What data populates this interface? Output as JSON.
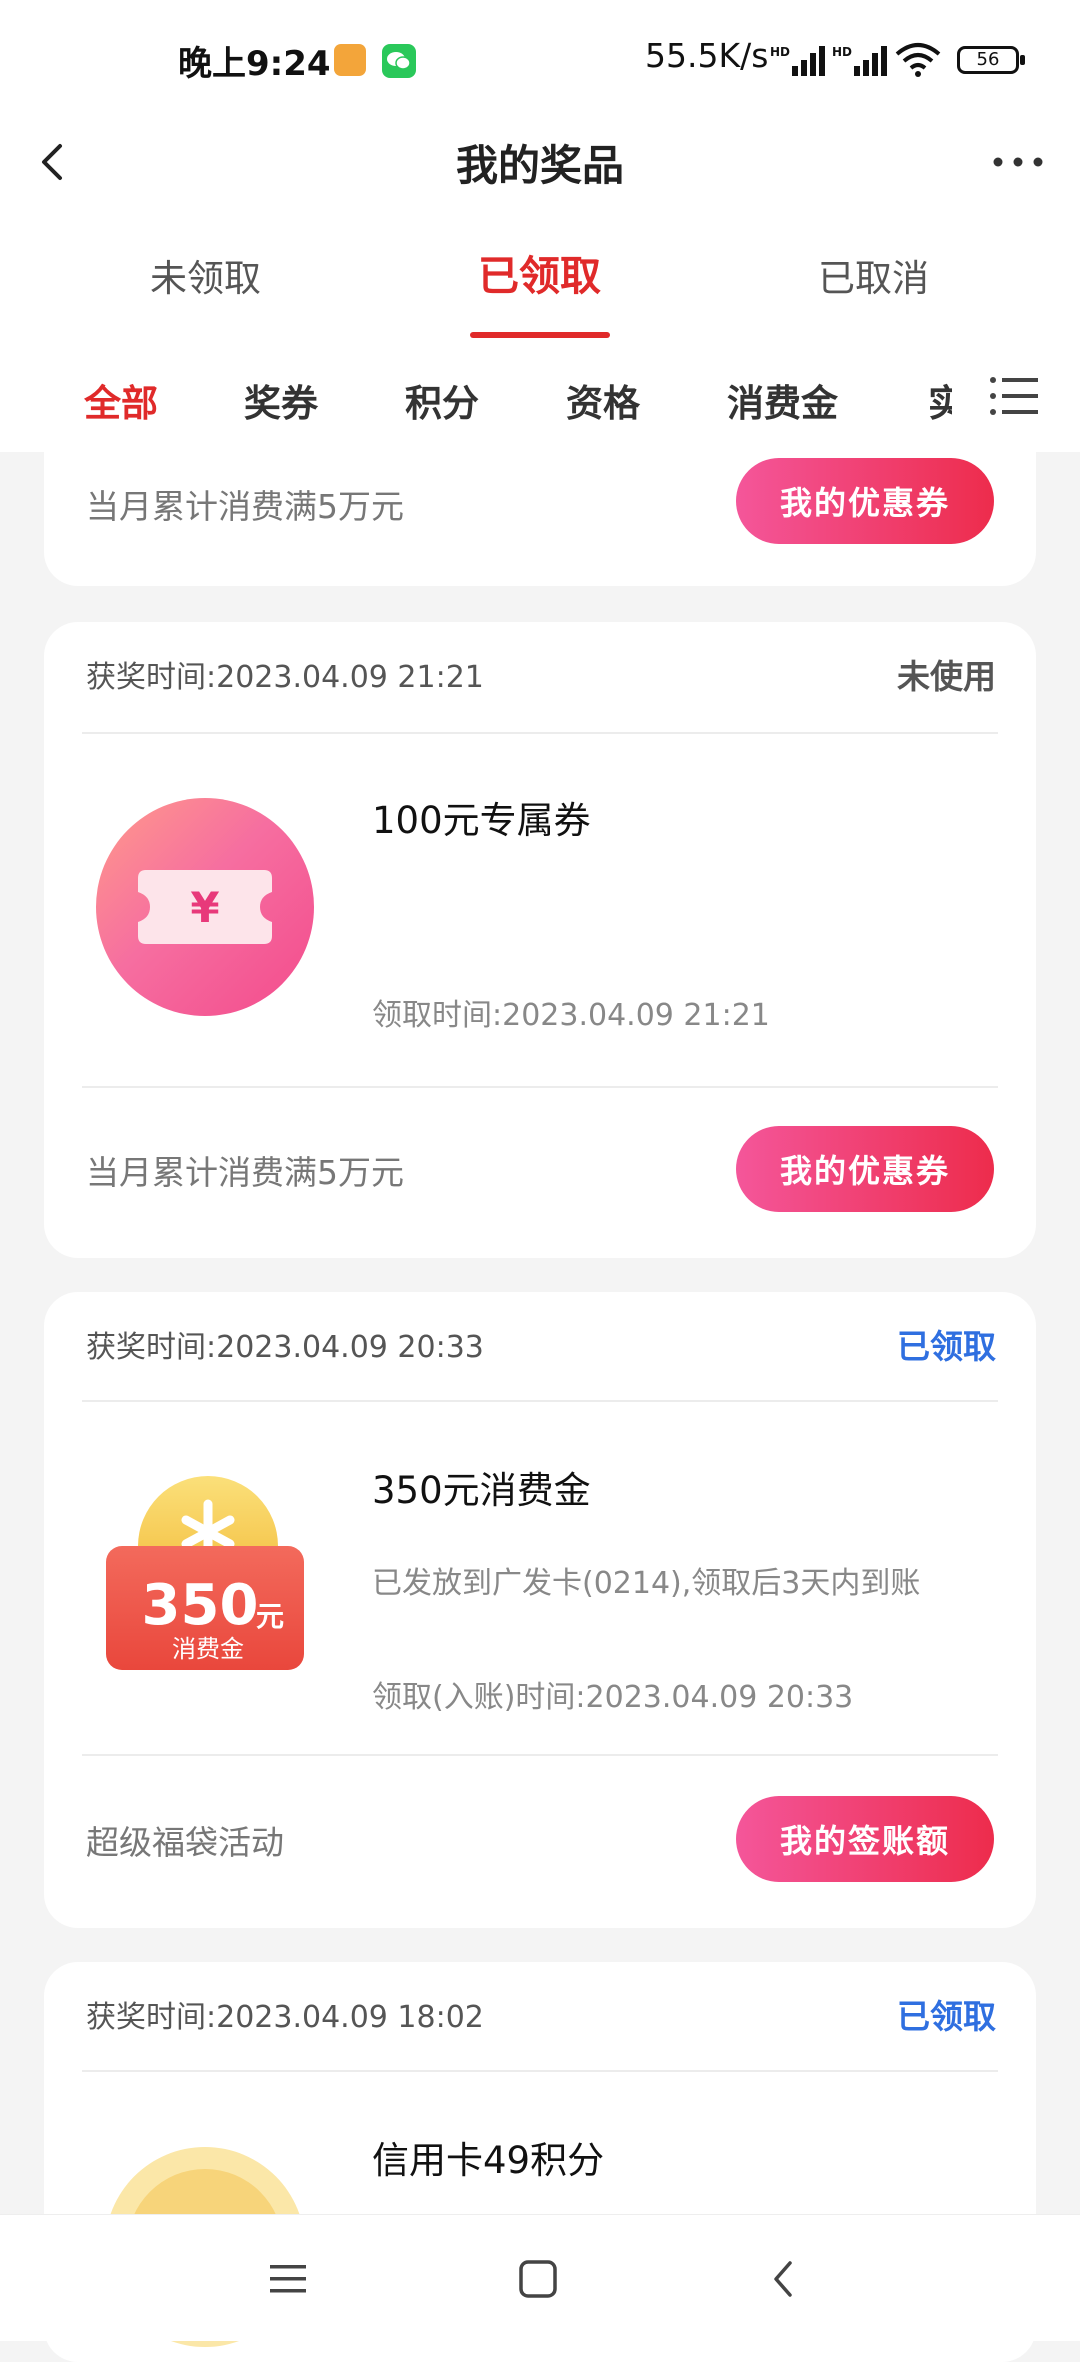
{
  "status_bar": {
    "time": "晚上9:24",
    "net_speed": "55.5K/s",
    "battery": "56",
    "signal1_label": "HD",
    "signal2_label": "HD"
  },
  "header": {
    "title": "我的奖品",
    "back_icon": "chevron-left-icon",
    "more_icon": "more-horizontal-icon"
  },
  "tabs": [
    {
      "label": "未领取",
      "active": false
    },
    {
      "label": "已领取",
      "active": true
    },
    {
      "label": "已取消",
      "active": false
    }
  ],
  "categories": [
    "全部",
    "奖券",
    "积分",
    "资格",
    "消费金",
    "实"
  ],
  "colors": {
    "accent": "#e02a2a",
    "status_unused": "#555555",
    "status_claimed": "#2f6fe0",
    "button_gradient_start": "#f4569a",
    "button_gradient_end": "#ed2c4c"
  },
  "cards": {
    "partial": {
      "condition": "当月累计消费满5万元",
      "button": "我的优惠券"
    },
    "coupon": {
      "award_time": "获奖时间:2023.04.09 21:21",
      "status": "未使用",
      "name": "100元专属券",
      "claim_time": "领取时间:2023.04.09 21:21",
      "condition": "当月累计消费满5万元",
      "button": "我的优惠券",
      "icon": "yen-ticket-icon",
      "icon_text": "¥"
    },
    "cash": {
      "award_time": "获奖时间:2023.04.09 20:33",
      "status": "已领取",
      "name": "350元消费金",
      "desc": "已发放到广发卡(0214),领取后3天内到账",
      "claim_time": "领取(入账)时间:2023.04.09 20:33",
      "condition": "超级福袋活动",
      "button": "我的签账额",
      "badge_amount": "350",
      "badge_unit": "元",
      "badge_label": "消费金",
      "icon": "coin-badge-icon"
    },
    "points": {
      "award_time": "获奖时间:2023.04.09 18:02",
      "status": "已领取",
      "name": "信用卡49积分",
      "icon": "gold-coin-icon"
    }
  },
  "nav": {
    "menu_icon": "menu-icon",
    "home_icon": "home-square-icon",
    "back_icon": "back-triangle-icon"
  }
}
